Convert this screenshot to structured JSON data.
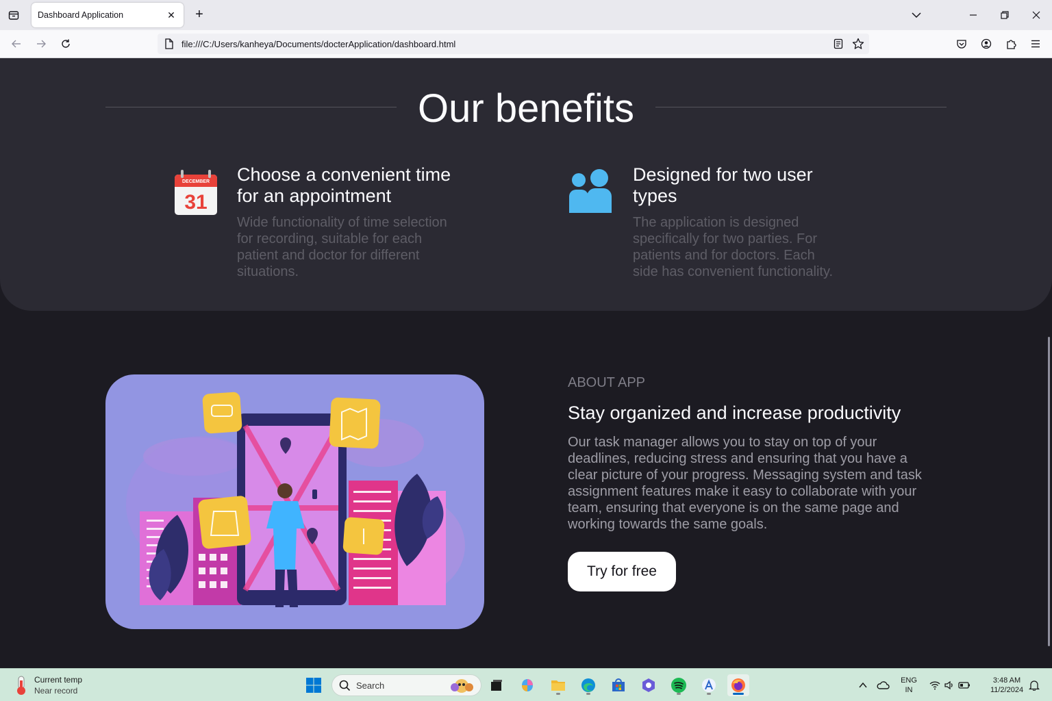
{
  "browser": {
    "tab_title": "Dashboard Application",
    "url": "file:///C:/Users/kanheya/Documents/docterApplication/dashboard.html"
  },
  "benefits": {
    "title": "Our benefits",
    "items": [
      {
        "icon": "calendar-icon",
        "icon_month": "DECEMBER",
        "icon_day": "31",
        "title_line1": "Choose a convenient time",
        "title_line2": "for an appointment",
        "desc_lines": [
          "Wide functionality of time selection",
          "for recording, suitable for each",
          "patient and doctor for different",
          "situations."
        ]
      },
      {
        "icon": "users-icon",
        "title_line1": "Designed for two user",
        "title_line2": "types",
        "desc_lines": [
          "The application is designed",
          "specifically for two parties. For",
          "patients and for doctors. Each",
          "side has convenient functionality."
        ]
      }
    ]
  },
  "about": {
    "kicker": "ABOUT APP",
    "title": "Stay organized and increase productivity",
    "text_lines": [
      "Our task manager allows you to stay on top of your",
      "deadlines, reducing stress and ensuring that you have a",
      "clear picture of your progress. Messaging system and task",
      "assignment features make it easy to collaborate with your",
      "team, ensuring that everyone is on the same page and",
      "working towards the same goals."
    ],
    "cta": "Try for free"
  },
  "taskbar": {
    "weather_title": "Current temp",
    "weather_note": "Near record",
    "search_placeholder": "Search",
    "lang_line1": "ENG",
    "lang_line2": "IN",
    "time": "3:48 AM",
    "date": "11/2/2024"
  },
  "colors": {
    "page_bg": "#1c1b22",
    "panel_bg": "#2b2a33",
    "illustration_bg": "#9295e2",
    "calendar_red": "#e8423a",
    "users_blue": "#4fb8f0",
    "taskbar_bg": "#cfe8da"
  }
}
